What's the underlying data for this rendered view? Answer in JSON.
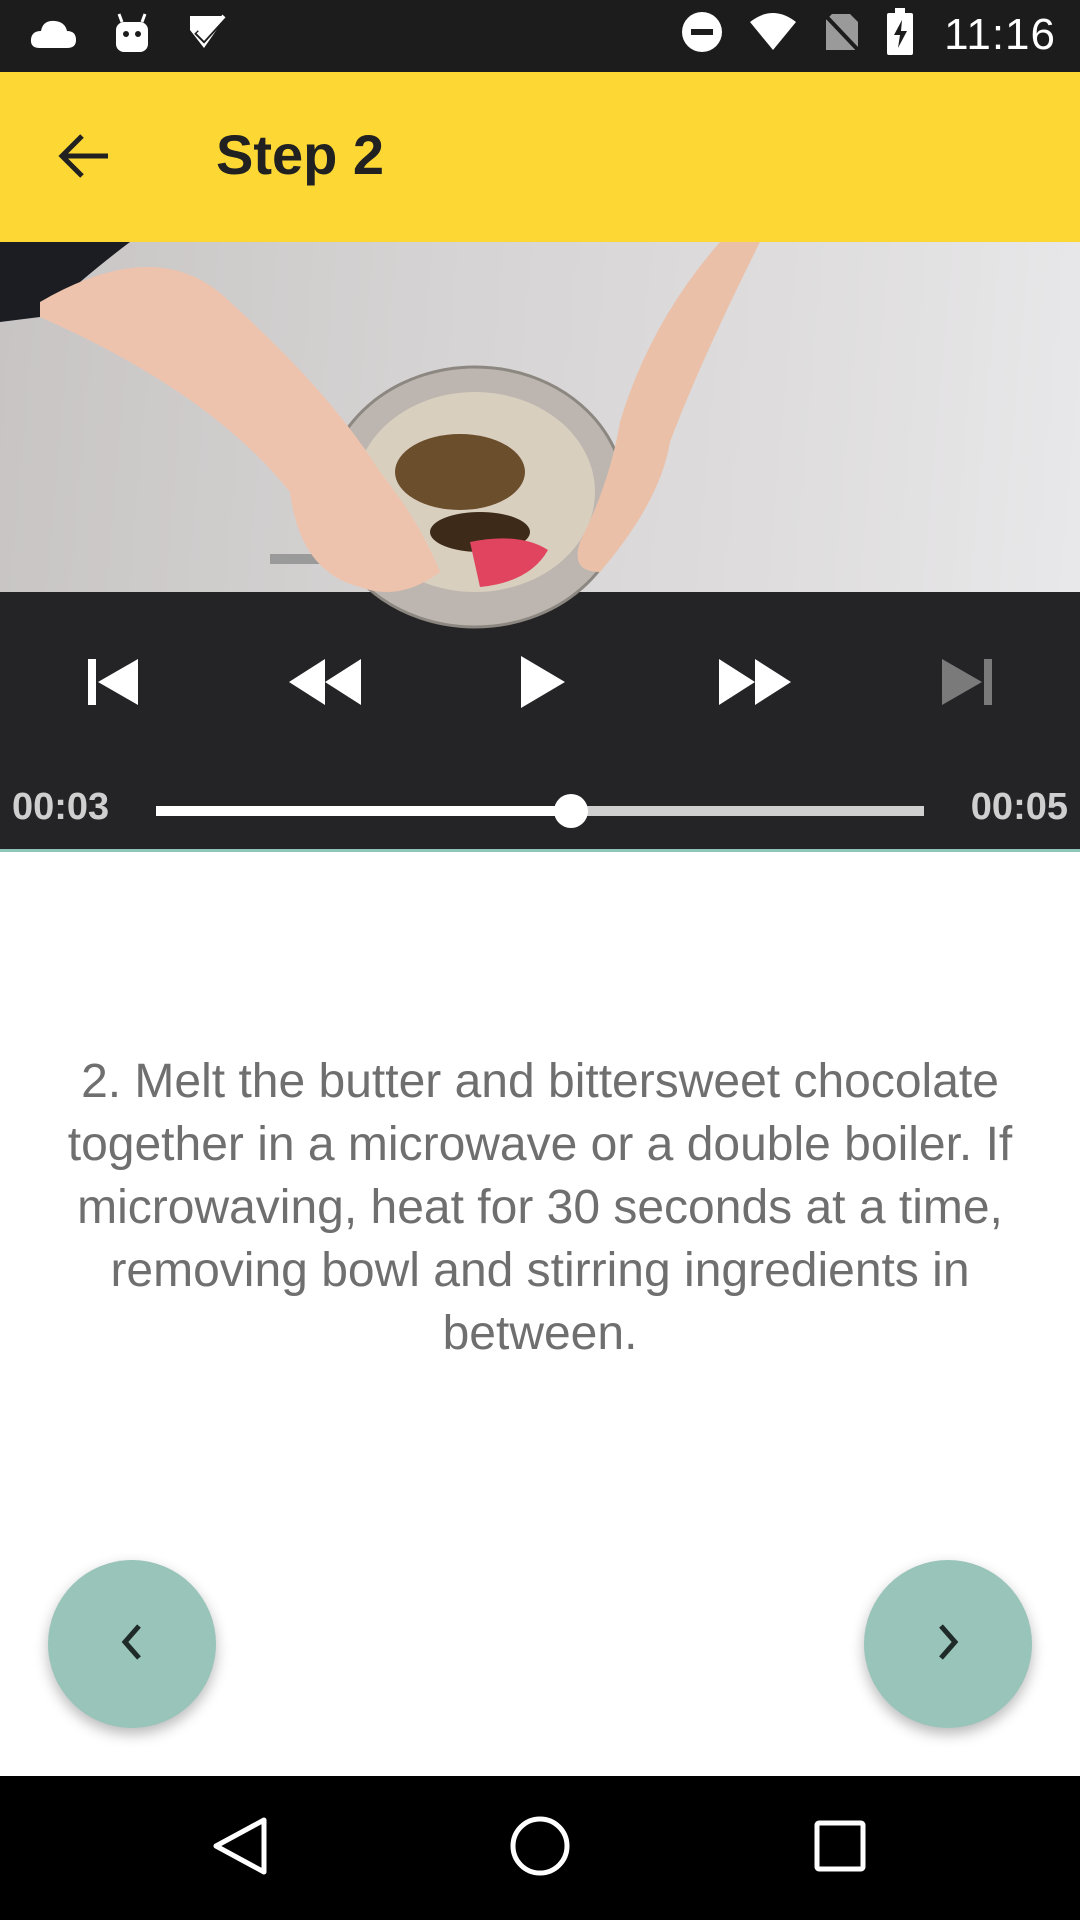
{
  "status_bar": {
    "time": "11:16",
    "icons": [
      "cloud-icon",
      "android-icon",
      "checklist-icon",
      "do-not-disturb-icon",
      "wifi-icon",
      "no-sim-icon",
      "battery-charging-icon"
    ]
  },
  "app_bar": {
    "title": "Step 2",
    "back_icon": "arrow-back-icon"
  },
  "player": {
    "current_time": "00:03",
    "total_time": "00:05",
    "progress": 0.54,
    "controls": [
      "skip-previous-icon",
      "rewind-icon",
      "play-icon",
      "fast-forward-icon",
      "skip-next-icon"
    ],
    "skip_next_enabled": false
  },
  "step": {
    "description": "2. Melt the butter and bittersweet chocolate together in a microwave or a double boiler. If microwaving, heat for 30 seconds at a time, removing bowl and stirring ingredients in between."
  },
  "navigation": {
    "prev_icon": "chevron-left-icon",
    "next_icon": "chevron-right-icon"
  },
  "system_nav": [
    "back-triangle-icon",
    "home-circle-icon",
    "recents-square-icon"
  ],
  "colors": {
    "app_bar": "#fdd835",
    "fab": "#98c4b9",
    "player_bg": "#242426",
    "text_secondary": "#6f6f6f"
  }
}
